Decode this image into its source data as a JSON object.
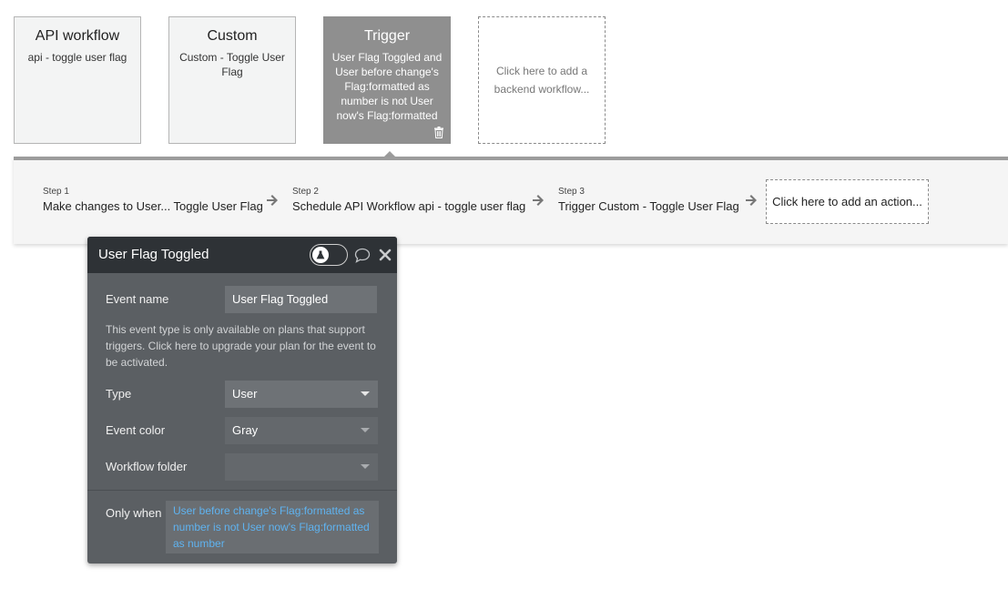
{
  "cards": [
    {
      "title": "API workflow",
      "subtitle": "api - toggle user flag"
    },
    {
      "title": "Custom",
      "subtitle": "Custom - Toggle User Flag"
    },
    {
      "title": "Trigger",
      "subtitle": "User Flag Toggled and User before change's Flag:formatted as number is not User now's Flag:formatted as number"
    },
    {
      "title": "",
      "subtitle": "Click here to add a backend workflow..."
    }
  ],
  "steps": [
    {
      "number": "Step 1",
      "label": "Make changes to User... Toggle User Flag"
    },
    {
      "number": "Step 2",
      "label": "Schedule API Workflow api - toggle user flag"
    },
    {
      "number": "Step 3",
      "label": "Trigger Custom - Toggle User Flag"
    }
  ],
  "add_action_label": "Click here to add an action...",
  "panel": {
    "title": "User Flag Toggled",
    "event_name_label": "Event name",
    "event_name_value": "User Flag Toggled",
    "notice": "This event type is only available on plans that support triggers. Click here to upgrade your plan for the event to be activated.",
    "type_label": "Type",
    "type_value": "User",
    "color_label": "Event color",
    "color_value": "Gray",
    "folder_label": "Workflow folder",
    "folder_value": "",
    "only_when_label": "Only when",
    "only_when_value": "User before change's Flag:formatted as number is not User now's Flag:formatted as number"
  },
  "colors": {
    "selected_card": "#8f8f8f",
    "panel_header": "#2e3236",
    "panel_body": "#5b5f63",
    "condition_text": "#5fb3f0"
  }
}
